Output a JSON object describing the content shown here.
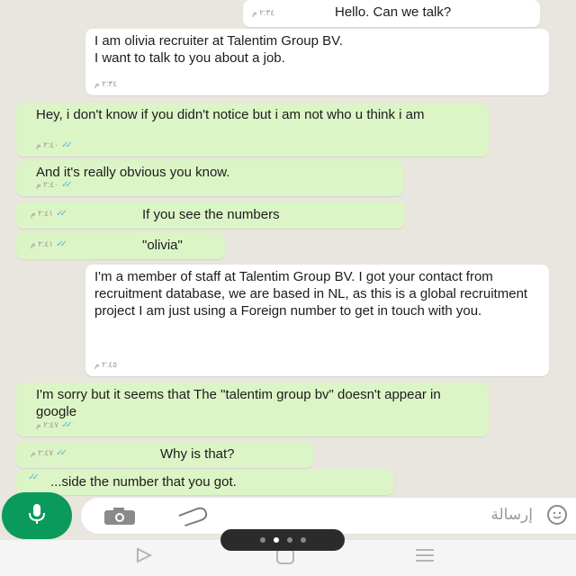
{
  "messages": [
    {
      "side": "in",
      "text": "Hello. Can we talk?",
      "time": "٢:٣٤ م"
    },
    {
      "side": "in",
      "text": "I am olivia recruiter at Talentim Group BV.\nI want to talk to you about a job.",
      "time": "٢:٣٤ م"
    },
    {
      "side": "out",
      "text": "Hey, i don't know if you didn't notice but i am not who u think i am",
      "time": "٢:٤٠ م"
    },
    {
      "side": "out",
      "text": "And it's really obvious you know.",
      "time": "٢:٤٠ م"
    },
    {
      "side": "out",
      "text": "If you see the numbers",
      "time": "٢:٤١ م"
    },
    {
      "side": "out",
      "text": "\"olivia\"",
      "time": "٢:٤١ م"
    },
    {
      "side": "in",
      "text": "I'm a member of staff at Talentim Group BV. I got your contact from recruitment database, we are based in NL, as this is a global recruitment project I am just using a Foreign number to get in touch with you.",
      "time": "٢:٤٥ م"
    },
    {
      "side": "out",
      "text": "I'm sorry but it seems that The \"talentim group bv\" doesn't appear in google",
      "time": "٢:٤٧ م"
    },
    {
      "side": "out",
      "text": "Why is that?",
      "time": "٢:٤٧ م"
    },
    {
      "side": "out",
      "text": "...side the number that you got.",
      "time": ""
    }
  ],
  "composer": {
    "placeholder": "إرسالة"
  },
  "icons": {
    "mic": "mic-icon",
    "camera": "camera-icon",
    "attach": "paperclip-icon",
    "emoji": "emoji-icon",
    "back": "back-icon",
    "home": "home-icon",
    "recents": "recents-icon"
  }
}
